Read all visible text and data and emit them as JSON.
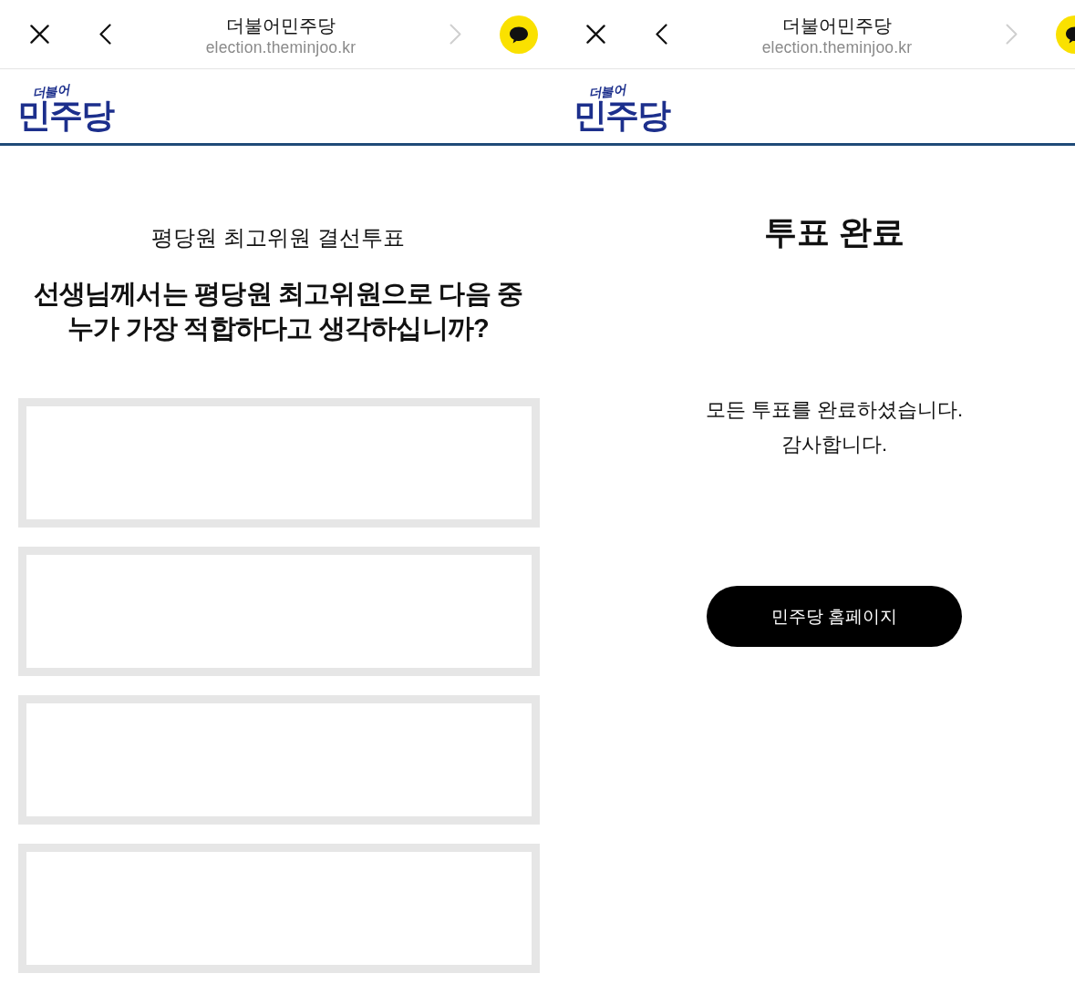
{
  "screens": [
    {
      "kind": "ballot",
      "browser_bar": {
        "title": "더불어민주당",
        "url": "election.theminjoo.kr",
        "forward_disabled": true
      },
      "logo": {
        "script": "더불어",
        "wordmark": "민주당"
      },
      "subtitle": "평당원 최고위원 결선투표",
      "question": "선생님께서는 평당원 최고위원으로 다음 중\n누가 가장 적합하다고 생각하십니까?",
      "options": [
        {
          "selected": false
        },
        {
          "selected": false
        },
        {
          "selected": false
        },
        {
          "selected": false
        }
      ]
    },
    {
      "kind": "complete",
      "browser_bar": {
        "title": "더불어민주당",
        "url": "election.theminjoo.kr",
        "forward_disabled": true
      },
      "logo": {
        "script": "더불어",
        "wordmark": "민주당"
      },
      "heading": "투표 완료",
      "message": "모든 투표를 완료하셨습니다.\n감사합니다.",
      "button": "민주당 홈페이지"
    }
  ]
}
